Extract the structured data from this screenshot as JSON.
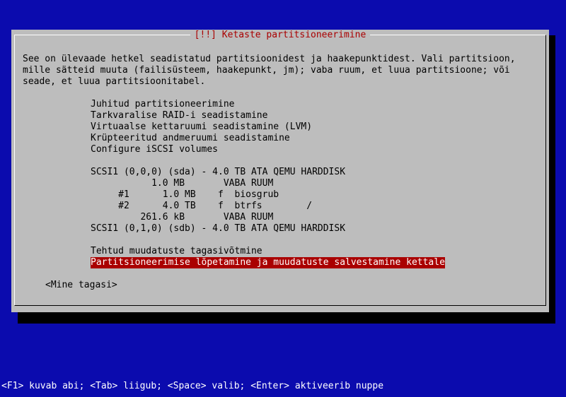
{
  "dialog": {
    "title": "[!!] Ketaste partitsioneerimine",
    "intro": [
      "See on ülevaade hetkel seadistatud partitsioonidest ja haakepunktidest. Vali partitsioon,",
      "mille sätteid muuta (failisüsteem, haakepunkt, jm); vaba ruum, et luua partitsioone; või",
      "seade, et luua partitsioonitabel."
    ],
    "menu": [
      "Juhitud partitsioneerimine",
      "Tarkvaralise RAID-i seadistamine",
      "Virtuaalse kettaruumi seadistamine (LVM)",
      "Krüpteeritud andmeruumi seadistamine",
      "Configure iSCSI volumes"
    ],
    "disks": [
      "SCSI1 (0,0,0) (sda) - 4.0 TB ATA QEMU HARDDISK",
      "           1.0 MB       VABA RUUM",
      "     #1      1.0 MB    f  biosgrub",
      "     #2      4.0 TB    f  btrfs        /",
      "         261.6 kB       VABA RUUM",
      "SCSI1 (0,1,0) (sdb) - 4.0 TB ATA QEMU HARDDISK"
    ],
    "actions": [
      "Tehtud muudatuste tagasivõtmine",
      "Partitsioneerimise lõpetamine ja muudatuste salvestamine kettale"
    ],
    "back_button": "<Mine tagasi>"
  },
  "footer": "<F1> kuvab abi; <Tab> liigub; <Space> valib; <Enter> aktiveerib nuppe",
  "colors": {
    "background": "#0b0bae",
    "dialog": "#bdbdbd",
    "title": "#aa0000",
    "selection": "#aa0000"
  }
}
